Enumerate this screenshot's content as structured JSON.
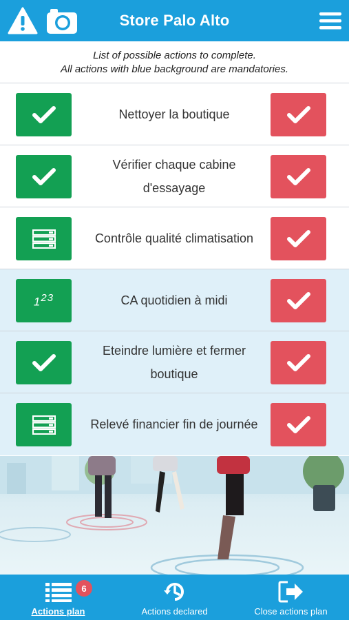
{
  "header": {
    "title": "Store Palo Alto",
    "left_icons": [
      "warning-icon",
      "camera-icon"
    ],
    "right_icon": "hamburger-menu-icon"
  },
  "instructions": {
    "line1": "List of possible actions to complete.",
    "line2": "All actions with blue background are mandatories."
  },
  "actions": [
    {
      "label": "Nettoyer la boutique",
      "left_icon": "checkmark-icon",
      "mandatory": false
    },
    {
      "label": "Vérifier chaque cabine d'essayage",
      "left_icon": "checkmark-icon",
      "mandatory": false
    },
    {
      "label": "Contrôle qualité climatisation",
      "left_icon": "list-form-icon",
      "mandatory": false
    },
    {
      "label": "CA quotidien à midi",
      "left_icon": "numbers-icon",
      "mandatory": true
    },
    {
      "label": "Eteindre lumière et fermer boutique",
      "left_icon": "checkmark-icon",
      "mandatory": true
    },
    {
      "label": "Relevé financier fin de journée",
      "left_icon": "list-form-icon",
      "mandatory": true
    }
  ],
  "numbers_icon_text": {
    "a": "1",
    "b": "2",
    "c": "3"
  },
  "tabs": [
    {
      "label": "Actions plan",
      "icon": "list-icon",
      "badge": "6",
      "active": true
    },
    {
      "label": "Actions declared",
      "icon": "history-icon",
      "active": false
    },
    {
      "label": "Close actions plan",
      "icon": "exit-icon",
      "active": false
    }
  ],
  "colors": {
    "brand_blue": "#1b9fdc",
    "validate_green": "#13a053",
    "refuse_red": "#e3525d",
    "mandatory_bg": "#dff0f9"
  }
}
